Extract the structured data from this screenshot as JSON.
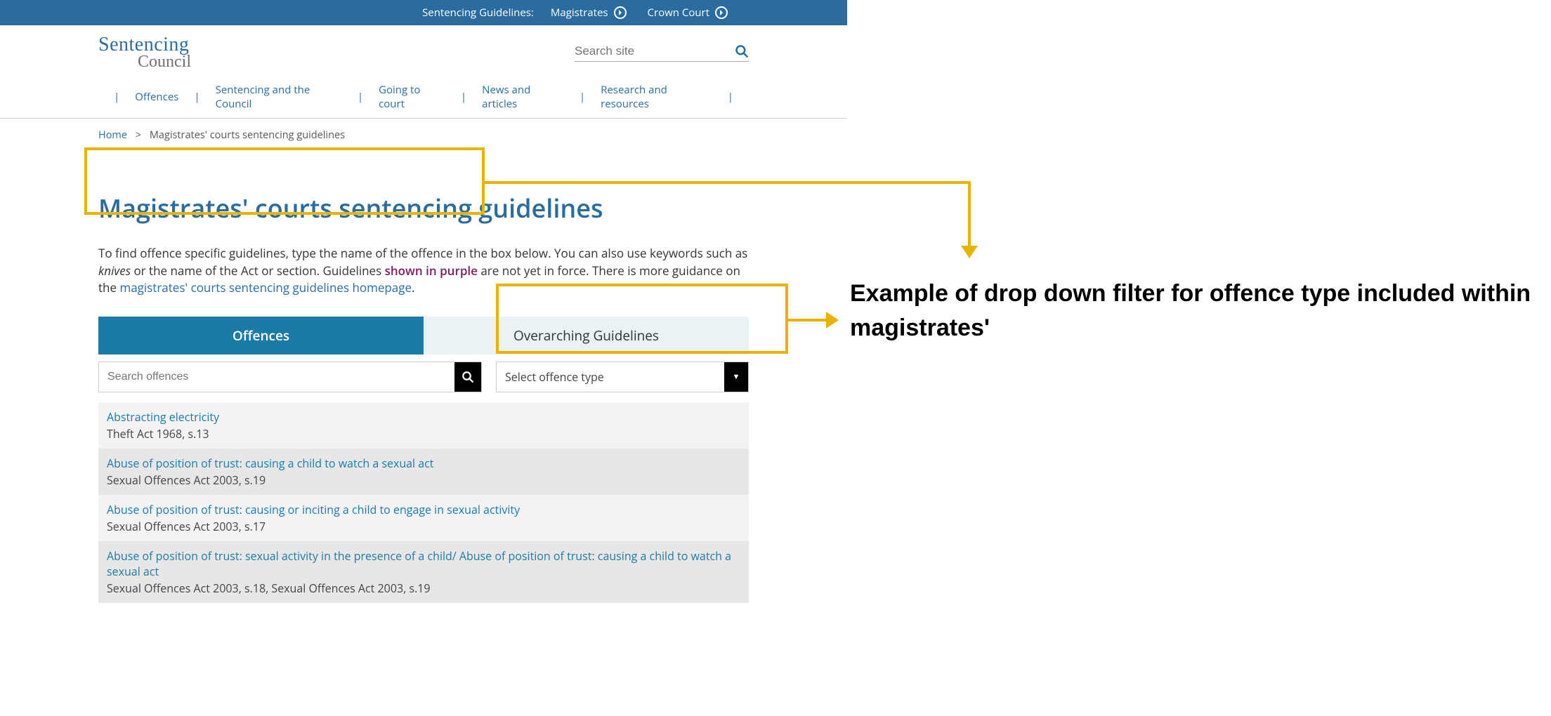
{
  "topbar": {
    "label": "Sentencing Guidelines:",
    "links": [
      {
        "label": "Magistrates"
      },
      {
        "label": "Crown Court"
      }
    ]
  },
  "logo": {
    "line1": "Sentencing",
    "line2": "Council"
  },
  "search": {
    "placeholder": "Search site"
  },
  "nav": {
    "items": [
      "Offences",
      "Sentencing and the Council",
      "Going to court",
      "News and articles",
      "Research and resources"
    ]
  },
  "breadcrumb": {
    "home": "Home",
    "sep": ">",
    "current": "Magistrates' courts sentencing guidelines"
  },
  "page_title": "Magistrates' courts sentencing guidelines",
  "intro": {
    "p1a": "To find offence specific guidelines, type the name of the offence in the box below. You can also use keywords such as ",
    "p1b_italic": "knives",
    "p1c": " or the name of the Act or section. Guidelines ",
    "p1d_purple": "shown in purple",
    "p1e": " are not yet in force. There is more guidance on the ",
    "p1f_link": "magistrates' courts sentencing guidelines homepage",
    "p1g": "."
  },
  "tabs": {
    "active": "Offences",
    "inactive": "Overarching Guidelines"
  },
  "filters": {
    "search_placeholder": "Search offences",
    "select_placeholder": "Select offence type"
  },
  "results": [
    {
      "title": "Abstracting electricity",
      "sub": "Theft Act 1968, s.13"
    },
    {
      "title": "Abuse of position of trust: causing a child to watch a sexual act",
      "sub": "Sexual Offences Act 2003, s.19"
    },
    {
      "title": "Abuse of position of trust: causing or inciting a child to engage in sexual activity",
      "sub": "Sexual Offences Act 2003, s.17"
    },
    {
      "title": "Abuse of position of trust: sexual activity in the presence of a child/ Abuse of position of trust: causing a child to watch a sexual act",
      "sub": "Sexual Offences Act 2003, s.18, Sexual Offences Act 2003, s.19"
    }
  ],
  "annotation": {
    "side_note": "Example of drop down filter for offence type included within magistrates'"
  }
}
